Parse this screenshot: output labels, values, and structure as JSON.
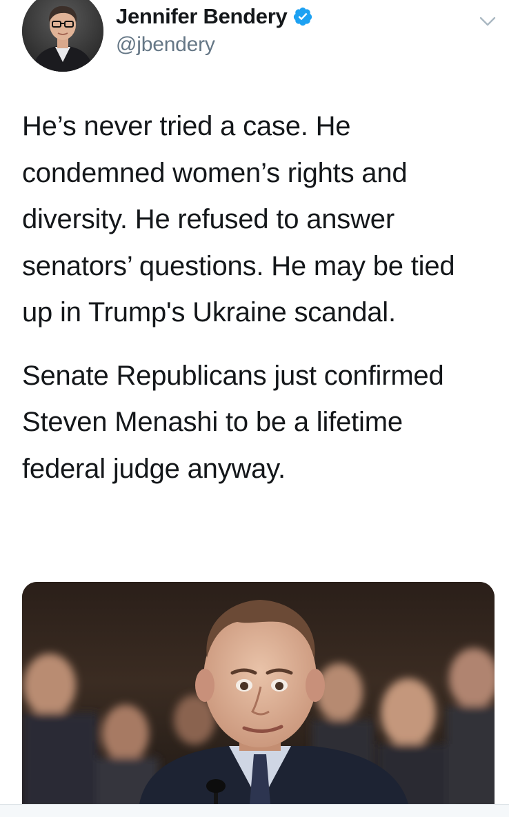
{
  "author": {
    "display_name": "Jennifer Bendery",
    "handle": "@jbendery",
    "verified": true,
    "verified_icon": "verified-badge-icon",
    "avatar": "author-avatar-photo"
  },
  "menu_icon": "chevron-down-icon",
  "tweet": {
    "paragraphs": [
      "He’s never tried a case. He condemned women’s rights and diversity. He refused to answer senators’ questions. He may be tied up in Trump's Ukraine scandal.",
      "Senate Republicans just confirmed Steven Menashi to be a lifetime federal judge anyway."
    ]
  },
  "media": {
    "type": "photo",
    "subject": "man-at-hearing-photo"
  },
  "colors": {
    "text": "#14171a",
    "secondary_text": "#657786",
    "verified_blue": "#1da1f2",
    "divider": "#d7dde2"
  }
}
